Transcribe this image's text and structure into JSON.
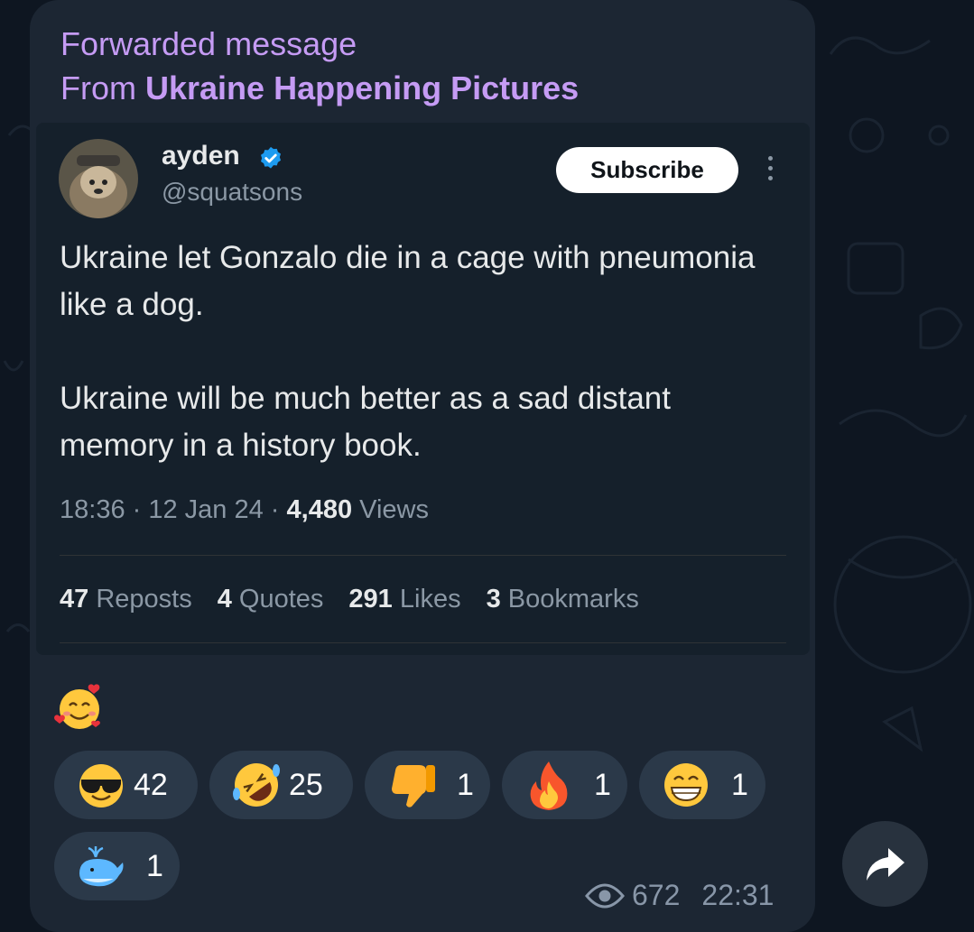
{
  "forward": {
    "header": "Forwarded message",
    "from_prefix": "From ",
    "from_name": "Ukraine Happening Pictures"
  },
  "tweet": {
    "author_name": "ayden",
    "author_handle": "@squatsons",
    "subscribe_label": "Subscribe",
    "paragraphs": [
      "Ukraine let Gonzalo die in a cage with pneumonia like a dog.",
      "Ukraine will be much better as a sad distant memory in a history book."
    ],
    "time": "18:36",
    "date": "12 Jan 24",
    "views_count": "4,480",
    "views_label": "Views",
    "stats": {
      "reposts_count": "47",
      "reposts_label": "Reposts",
      "quotes_count": "4",
      "quotes_label": "Quotes",
      "likes_count": "291",
      "likes_label": "Likes",
      "bookmarks_count": "3",
      "bookmarks_label": "Bookmarks"
    }
  },
  "message_emoji": "smiling-face-with-hearts",
  "reactions": [
    {
      "emoji": "smiling-face-with-sunglasses",
      "count": "42"
    },
    {
      "emoji": "rolling-on-floor-laughing",
      "count": "25"
    },
    {
      "emoji": "thumbs-down",
      "count": "1"
    },
    {
      "emoji": "fire",
      "count": "1"
    },
    {
      "emoji": "beaming-face",
      "count": "1"
    },
    {
      "emoji": "spouting-whale",
      "count": "1"
    }
  ],
  "footer": {
    "views": "672",
    "time": "22:31"
  },
  "colors": {
    "forward_accent": "#c59bf4",
    "bubble": "#1c2633",
    "tweet_bg": "#15202b",
    "verified": "#1d9bf0"
  }
}
